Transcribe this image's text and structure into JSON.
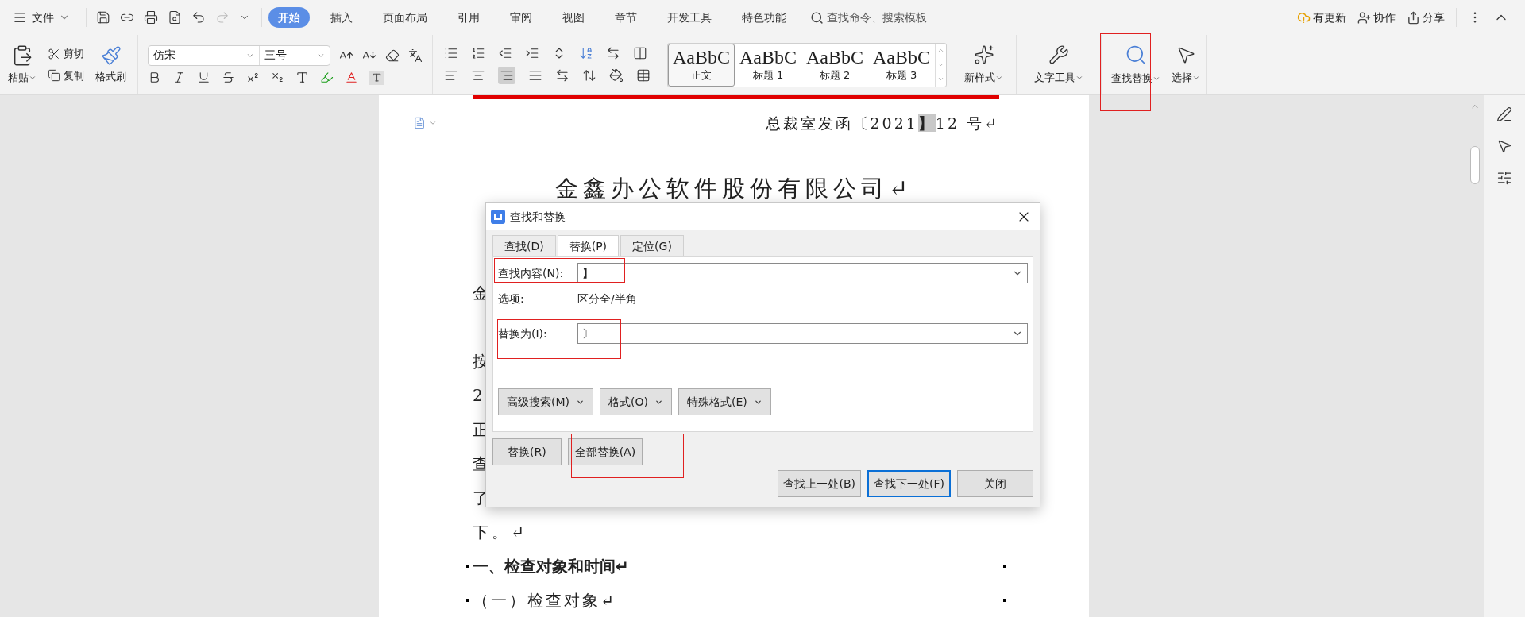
{
  "menu": {
    "file": "文件",
    "tabs": [
      {
        "label": "开始",
        "selected": true
      },
      {
        "label": "插入",
        "selected": false
      },
      {
        "label": "页面布局",
        "selected": false
      },
      {
        "label": "引用",
        "selected": false
      },
      {
        "label": "审阅",
        "selected": false
      },
      {
        "label": "视图",
        "selected": false
      },
      {
        "label": "章节",
        "selected": false
      },
      {
        "label": "开发工具",
        "selected": false
      },
      {
        "label": "特色功能",
        "selected": false
      }
    ],
    "search_placeholder": "查找命令、搜索模板",
    "actions": [
      {
        "kind": "update",
        "label": "有更新"
      },
      {
        "kind": "collab",
        "label": "协作"
      },
      {
        "kind": "share",
        "label": "分享"
      }
    ]
  },
  "ribbon": {
    "paste": "粘贴",
    "cut": "剪切",
    "copy": "复制",
    "format_painter": "格式刷",
    "font_name": "仿宋",
    "font_size": "三号",
    "styles": [
      {
        "sample": "AaBbC",
        "label": "正文",
        "selected": true
      },
      {
        "sample": "AaBbC",
        "label": "标题 1",
        "selected": false
      },
      {
        "sample": "AaBbC",
        "label": "标题 2",
        "selected": false
      },
      {
        "sample": "AaBbC",
        "label": "标题 3",
        "selected": false
      }
    ],
    "new_style": "新样式",
    "text_tools": "文字工具",
    "find_replace": "查找替换",
    "select": "选择"
  },
  "document": {
    "header_before": "总裁室发函〔2021",
    "header_highlight": "】",
    "header_after": "12 号↵",
    "title": "金鑫办公软件股份有限公司↵",
    "first_fragment": "金",
    "fragments": [
      "按",
      "2",
      "正",
      "查",
      "了"
    ],
    "lines": [
      {
        "kind": "body",
        "text": "下。↵"
      },
      {
        "kind": "heading",
        "text": "一、检查对象和时间↵"
      },
      {
        "kind": "subheading",
        "text": "（一）检查对象↵"
      }
    ]
  },
  "dialog": {
    "title": "查找和替换",
    "tabs": [
      {
        "label": "查找(D)",
        "selected": false
      },
      {
        "label": "替换(P)",
        "selected": true
      },
      {
        "label": "定位(G)",
        "selected": false
      }
    ],
    "find_label": "查找内容(N):",
    "find_value": "】",
    "options_label": "选项:",
    "options_value": "区分全/半角",
    "replace_label": "替换为(I):",
    "replace_value": "〕",
    "option_buttons": [
      "高级搜索(M)",
      "格式(O)",
      "特殊格式(E)"
    ],
    "replace_button": "替换(R)",
    "replace_all_button": "全部替换(A)",
    "nav_buttons": [
      {
        "label": "查找上一处(B)",
        "focused": false
      },
      {
        "label": "查找下一处(F)",
        "focused": true
      },
      {
        "label": "关闭",
        "focused": false
      }
    ]
  }
}
